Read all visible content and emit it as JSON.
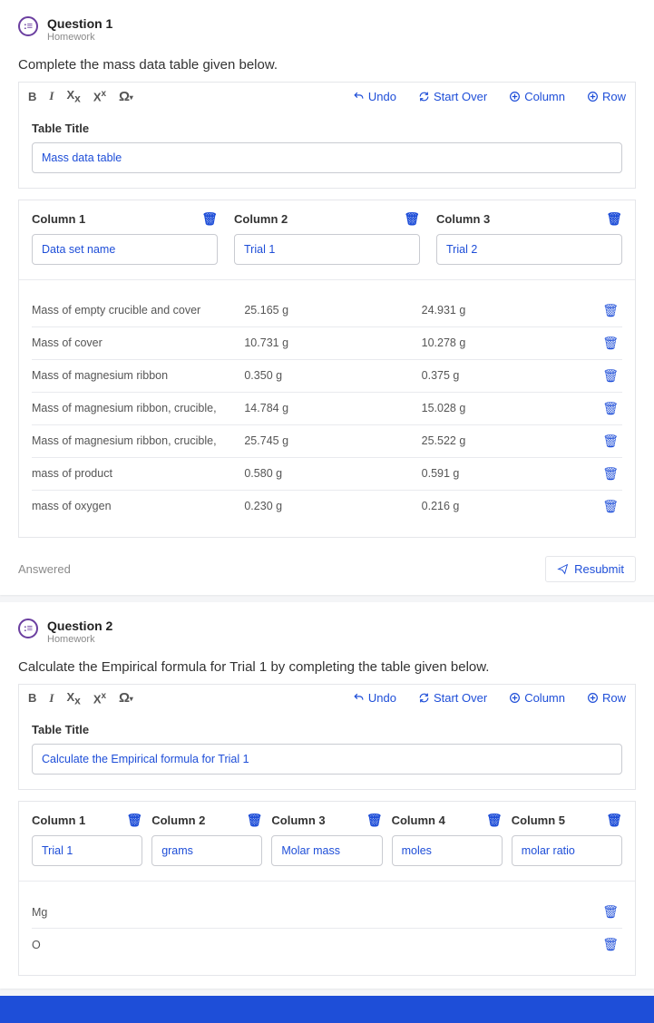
{
  "q1": {
    "title": "Question 1",
    "sub": "Homework",
    "prompt": "Complete the mass data table given below.",
    "toolbar": {
      "bold": "B",
      "italic": "I",
      "sub": "X",
      "subSuffix": "x",
      "sup": "X",
      "supSuffix": "x",
      "omega": "Ω",
      "caret": "▾",
      "undo": "Undo",
      "startover": "Start Over",
      "column": "Column",
      "row": "Row"
    },
    "tableTitleLabel": "Table Title",
    "tableTitle": "Mass data table",
    "colLabels": {
      "c1": "Column 1",
      "c2": "Column 2",
      "c3": "Column 3"
    },
    "colValues": {
      "c1": "Data set name",
      "c2": "Trial 1",
      "c3": "Trial 2"
    },
    "rows": [
      {
        "name": "Mass of empty crucible and cover",
        "t1": "25.165 g",
        "t2": "24.931 g"
      },
      {
        "name": "Mass of cover",
        "t1": "10.731 g",
        "t2": "10.278 g"
      },
      {
        "name": "Mass of magnesium ribbon",
        "t1": "0.350 g",
        "t2": "0.375 g"
      },
      {
        "name": "Mass of magnesium ribbon, crucible,",
        "t1": "14.784 g",
        "t2": "15.028 g"
      },
      {
        "name": "Mass of magnesium ribbon, crucible,",
        "t1": "25.745 g",
        "t2": "25.522 g"
      },
      {
        "name": "mass of product",
        "t1": "0.580 g",
        "t2": "0.591 g"
      },
      {
        "name": "mass of oxygen",
        "t1": "0.230 g",
        "t2": "0.216 g"
      }
    ],
    "answered": "Answered",
    "resubmit": "Resubmit"
  },
  "q2": {
    "title": "Question 2",
    "sub": "Homework",
    "prompt": "Calculate the Empirical formula for Trial 1 by completing the table given below.",
    "tableTitleLabel": "Table Title",
    "tableTitle": "Calculate the Empirical formula for Trial 1",
    "colLabels": {
      "c1": "Column 1",
      "c2": "Column 2",
      "c3": "Column 3",
      "c4": "Column 4",
      "c5": "Column 5"
    },
    "colValues": {
      "c1": "Trial 1",
      "c2": "grams",
      "c3": "Molar mass",
      "c4": "moles",
      "c5": "molar ratio"
    },
    "rows": [
      {
        "name": "Mg"
      },
      {
        "name": "O"
      }
    ]
  },
  "icons": {
    "trash": "🗑"
  }
}
